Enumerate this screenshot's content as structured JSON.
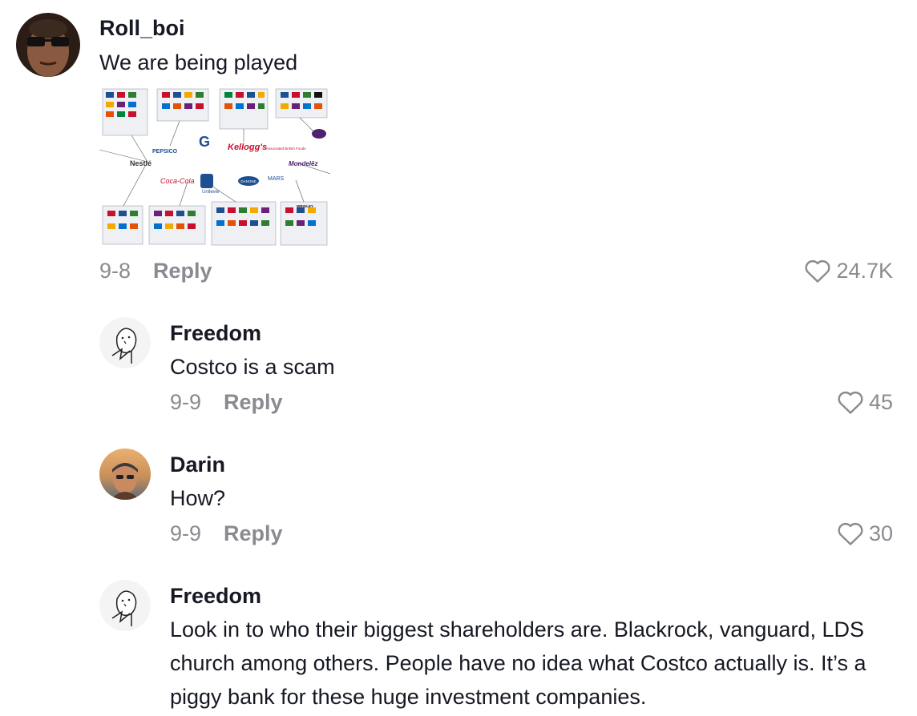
{
  "comments": [
    {
      "username": "Roll_boi",
      "text": "We are being played",
      "date": "9-8",
      "reply_label": "Reply",
      "likes": "24.7K",
      "attachment": {
        "labels": {
          "pepsico": "PEPSICO",
          "kelloggs": "Kellogg's",
          "abf": "Associated British Foods",
          "nestle": "Nestlé",
          "mondelez": "Mondelēz",
          "cocacola": "Coca-Cola",
          "unilever": "Unilever",
          "danone": "DANONE",
          "mars": "MARS",
          "wrigley": "WRIGLEY"
        }
      }
    },
    {
      "username": "Freedom",
      "text": "Costco is a scam",
      "date": "9-9",
      "reply_label": "Reply",
      "likes": "45"
    },
    {
      "username": "Darin",
      "text": "How?",
      "date": "9-9",
      "reply_label": "Reply",
      "likes": "30"
    },
    {
      "username": "Freedom",
      "text": "Look in to who their biggest shareholders are. Blackrock, vanguard, LDS church among others. People have no idea what Costco actually is. It’s a piggy bank for these huge investment companies."
    }
  ],
  "colors": {
    "text": "#161823",
    "muted": "#8a8b91"
  },
  "icons": {
    "like": "heart-outline-icon"
  }
}
